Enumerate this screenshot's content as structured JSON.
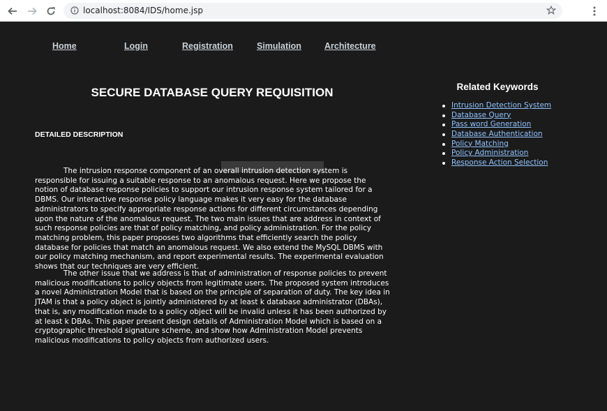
{
  "browser": {
    "url": "localhost:8084/IDS/home.jsp"
  },
  "nav": {
    "items": [
      {
        "label": "Home"
      },
      {
        "label": "Login"
      },
      {
        "label": "Registration"
      },
      {
        "label": "Simulation"
      },
      {
        "label": "Architecture"
      }
    ]
  },
  "main": {
    "title": "SECURE DATABASE QUERY REQUISITION",
    "section_heading": "DETAILED DESCRIPTION",
    "paragraph_1": "The intrusion response component of an overall intrusion detection system is responsible for issuing a suitable response to an anomalous request. Here we propose the notion of database response policies to support our intrusion response system tailored for a DBMS. Our interactive response policy language makes it very easy for the database administrators to specify appropriate response actions for different circumstances depending upon the nature of the anomalous request. The two main issues that are address in context of such response policies are that of policy matching, and policy administration. For the policy matching problem, this paper proposes two algorithms that efficiently search the policy database for policies that match an anomalous request. We also extend the MySQL DBMS with our policy matching mechanism, and report experimental results. The experimental evaluation shows that our techniques are very efficient.",
    "paragraph_2": "The other issue that we address is that of administration of response policies to prevent malicious modifications to policy objects from legitimate users. The proposed system introduces a novel Administration Model that is based on the principle of separation of duty. The key idea in JTAM is that a policy object is jointly administered by at least k database administrator (DBAs), that is, any modification made to a policy object will be invalid unless it has been authorized by at least k DBAs. This paper present design details of Administration Model which is based on a cryptographic threshold signature scheme, and show how Administration Model prevents malicious modifications to policy objects from authorized users."
  },
  "sidebar": {
    "title": "Related Keywords",
    "keywords": [
      {
        "label": "Intrusion Detection System"
      },
      {
        "label": "Database Query"
      },
      {
        "label": "Pass word Generation"
      },
      {
        "label": "Database Authentication"
      },
      {
        "label": "Policy Matching"
      },
      {
        "label": "Policy Administration"
      },
      {
        "label": "Response Action Selection"
      }
    ]
  },
  "colors": {
    "page_background": "#1b1b1b",
    "link": "#8fc3ff",
    "nav_link": "#c9d1d8"
  }
}
